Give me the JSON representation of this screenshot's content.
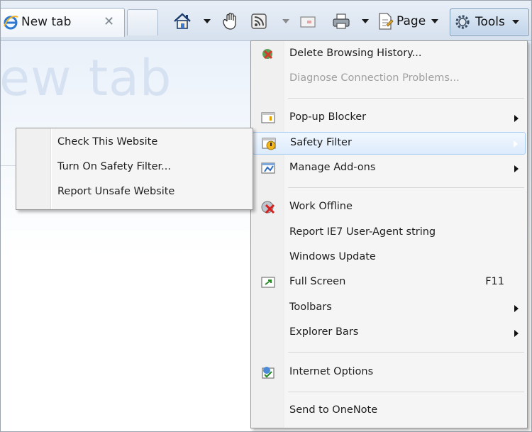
{
  "browser": {
    "tab_title": "New tab",
    "page_heading": "ew tab",
    "toolbar": {
      "page_label": "Page",
      "tools_label": "Tools"
    }
  },
  "tools_menu": {
    "items": [
      {
        "label": "Delete Browsing History...",
        "icon": "delete-history-icon"
      },
      {
        "label": "Diagnose Connection Problems...",
        "disabled": true
      },
      {
        "label": "Pop-up Blocker",
        "icon": "popup-blocker-icon",
        "submenu": true
      },
      {
        "label": "Safety Filter",
        "icon": "safety-filter-icon",
        "submenu": true,
        "highlighted": true
      },
      {
        "label": "Manage Add-ons",
        "icon": "addons-icon",
        "submenu": true
      },
      {
        "label": "Work Offline",
        "icon": "work-offline-icon"
      },
      {
        "label": "Report IE7 User-Agent string"
      },
      {
        "label": "Windows Update"
      },
      {
        "label": "Full Screen",
        "icon": "full-screen-icon",
        "shortcut": "F11"
      },
      {
        "label": "Toolbars",
        "submenu": true
      },
      {
        "label": "Explorer Bars",
        "submenu": true
      },
      {
        "label": "Internet Options",
        "icon": "internet-options-icon"
      },
      {
        "label": "Send to OneNote"
      }
    ]
  },
  "safety_submenu": {
    "items": [
      {
        "label": "Check This Website"
      },
      {
        "label": "Turn On Safety Filter..."
      },
      {
        "label": "Report Unsafe Website"
      }
    ]
  }
}
